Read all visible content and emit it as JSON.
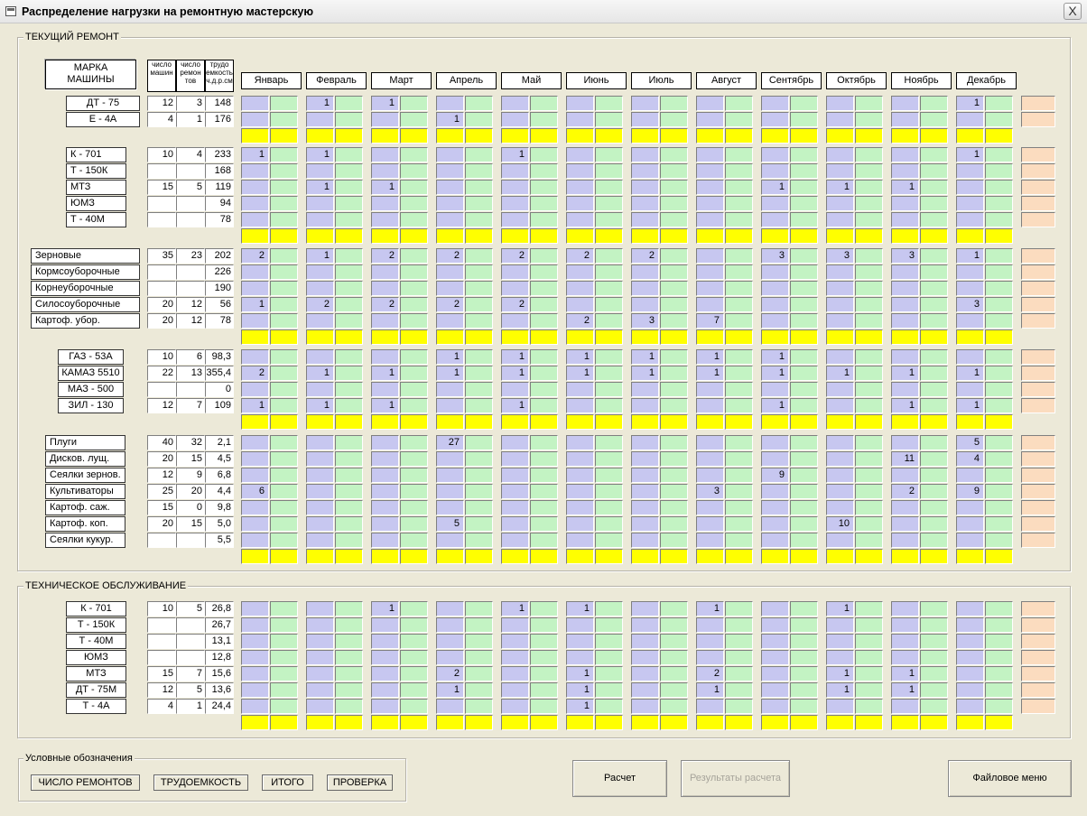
{
  "window": {
    "title": "Распределение нагрузки на ремонтную мастерскую",
    "close_label": "X"
  },
  "months": [
    "Январь",
    "Февраль",
    "Март",
    "Апрель",
    "Май",
    "Июнь",
    "Июль",
    "Август",
    "Сентябрь",
    "Октябрь",
    "Ноябрь",
    "Декабрь"
  ],
  "header": {
    "brand": "МАРКА\nМАШИНЫ",
    "col1": "число машин",
    "col2": "число ремон тов",
    "col3": "трудо емкость ч.д.р.см"
  },
  "current": {
    "title": "ТЕКУЩИЙ РЕМОНТ",
    "groups": [
      {
        "rows": [
          {
            "name": "ДТ - 75",
            "n": "12",
            "r": "3",
            "t": "148",
            "vals": {
              "1": "1",
              "2": "1",
              "11": "1"
            }
          },
          {
            "name": "Е - 4А",
            "n": "4",
            "r": "1",
            "t": "176",
            "vals": {
              "3": "1"
            }
          }
        ]
      },
      {
        "rows": [
          {
            "name": "К - 701",
            "n": "10",
            "r": "4",
            "t": "233",
            "vals": {
              "0": "1",
              "1": "1",
              "4": "1",
              "11": "1"
            }
          },
          {
            "name": "Т - 150К",
            "n": "",
            "r": "",
            "t": "168",
            "vals": {}
          },
          {
            "name": "МТЗ",
            "n": "15",
            "r": "5",
            "t": "119",
            "vals": {
              "1": "1",
              "2": "1",
              "8": "1",
              "9": "1",
              "10": "1"
            }
          },
          {
            "name": "ЮМЗ",
            "n": "",
            "r": "",
            "t": "94",
            "vals": {}
          },
          {
            "name": "Т - 40М",
            "n": "",
            "r": "",
            "t": "78",
            "vals": {}
          }
        ]
      },
      {
        "rows": [
          {
            "name": "Зерновые",
            "n": "35",
            "r": "23",
            "t": "202",
            "vals": {
              "0": "2",
              "1": "1",
              "2": "2",
              "3": "2",
              "4": "2",
              "5": "2",
              "6": "2",
              "8": "3",
              "9": "3",
              "10": "3",
              "11": "1"
            }
          },
          {
            "name": "Кормсоуборочные",
            "n": "",
            "r": "",
            "t": "226",
            "vals": {}
          },
          {
            "name": "Корнеуборочные",
            "n": "",
            "r": "",
            "t": "190",
            "vals": {}
          },
          {
            "name": "Силосоуборочные",
            "n": "20",
            "r": "12",
            "t": "56",
            "vals": {
              "0": "1",
              "1": "2",
              "2": "2",
              "3": "2",
              "4": "2",
              "11": "3"
            }
          },
          {
            "name": "Картоф. убор.",
            "n": "20",
            "r": "12",
            "t": "78",
            "vals": {
              "5": "2",
              "6": "3",
              "7": "7"
            }
          }
        ]
      },
      {
        "rows": [
          {
            "name": "ГАЗ - 53А",
            "n": "10",
            "r": "6",
            "t": "98,3",
            "vals": {
              "3": "1",
              "4": "1",
              "5": "1",
              "6": "1",
              "7": "1",
              "8": "1"
            }
          },
          {
            "name": "КАМАЗ 5510",
            "n": "22",
            "r": "13",
            "t": "355,4",
            "vals": {
              "0": "2",
              "1": "1",
              "2": "1",
              "3": "1",
              "4": "1",
              "5": "1",
              "6": "1",
              "7": "1",
              "8": "1",
              "9": "1",
              "10": "1",
              "11": "1"
            }
          },
          {
            "name": "МАЗ - 500",
            "n": "",
            "r": "",
            "t": "0",
            "vals": {}
          },
          {
            "name": "ЗИЛ - 130",
            "n": "12",
            "r": "7",
            "t": "109",
            "vals": {
              "0": "1",
              "1": "1",
              "2": "1",
              "4": "1",
              "8": "1",
              "10": "1",
              "11": "1"
            }
          }
        ]
      },
      {
        "rows": [
          {
            "name": "Плуги",
            "n": "40",
            "r": "32",
            "t": "2,1",
            "vals": {
              "3": "27",
              "11": "5"
            }
          },
          {
            "name": "Дисков. лущ.",
            "n": "20",
            "r": "15",
            "t": "4,5",
            "vals": {
              "10": "11",
              "11": "4"
            }
          },
          {
            "name": "Сеялки зернов.",
            "n": "12",
            "r": "9",
            "t": "6,8",
            "vals": {
              "8": "9"
            }
          },
          {
            "name": "Культиваторы",
            "n": "25",
            "r": "20",
            "t": "4,4",
            "vals": {
              "0": "6",
              "7": "3",
              "10": "2",
              "11": "9"
            }
          },
          {
            "name": "Картоф. саж.",
            "n": "15",
            "r": "0",
            "t": "9,8",
            "vals": {}
          },
          {
            "name": "Картоф. коп.",
            "n": "20",
            "r": "15",
            "t": "5,0",
            "vals": {
              "3": "5",
              "9": "10"
            }
          },
          {
            "name": "Сеялки кукур.",
            "n": "",
            "r": "",
            "t": "5,5",
            "vals": {}
          }
        ]
      }
    ]
  },
  "maintenance": {
    "title": "ТЕХНИЧЕСКОЕ ОБСЛУЖИВАНИЕ",
    "groups": [
      {
        "rows": [
          {
            "name": "К - 701",
            "n": "10",
            "r": "5",
            "t": "26,8",
            "vals": {
              "2": "1",
              "4": "1",
              "5": "1",
              "7": "1",
              "9": "1"
            }
          },
          {
            "name": "Т - 150К",
            "n": "",
            "r": "",
            "t": "26,7",
            "vals": {}
          },
          {
            "name": "Т - 40М",
            "n": "",
            "r": "",
            "t": "13,1",
            "vals": {}
          },
          {
            "name": "ЮМЗ",
            "n": "",
            "r": "",
            "t": "12,8",
            "vals": {}
          },
          {
            "name": "МТЗ",
            "n": "15",
            "r": "7",
            "t": "15,6",
            "vals": {
              "3": "2",
              "5": "1",
              "7": "2",
              "9": "1",
              "10": "1"
            }
          },
          {
            "name": "ДТ - 75М",
            "n": "12",
            "r": "5",
            "t": "13,6",
            "vals": {
              "3": "1",
              "5": "1",
              "7": "1",
              "9": "1",
              "10": "1"
            }
          },
          {
            "name": "Т - 4А",
            "n": "4",
            "r": "1",
            "t": "24,4",
            "vals": {
              "5": "1"
            }
          }
        ]
      }
    ]
  },
  "legend": {
    "title": "Условные обозначения",
    "items": [
      {
        "label": "ЧИСЛО РЕМОНТОВ",
        "color": "#c7c7f0"
      },
      {
        "label": "ТРУДОЕМКОСТЬ",
        "color": "#c3f3c3"
      },
      {
        "label": "ИТОГО",
        "color": "#ffff00"
      },
      {
        "label": "ПРОВЕРКА",
        "color": "#fbdcbf"
      }
    ]
  },
  "buttons": {
    "calc": "Расчет",
    "results": "Результаты расчета",
    "file_menu": "Файловое меню"
  }
}
